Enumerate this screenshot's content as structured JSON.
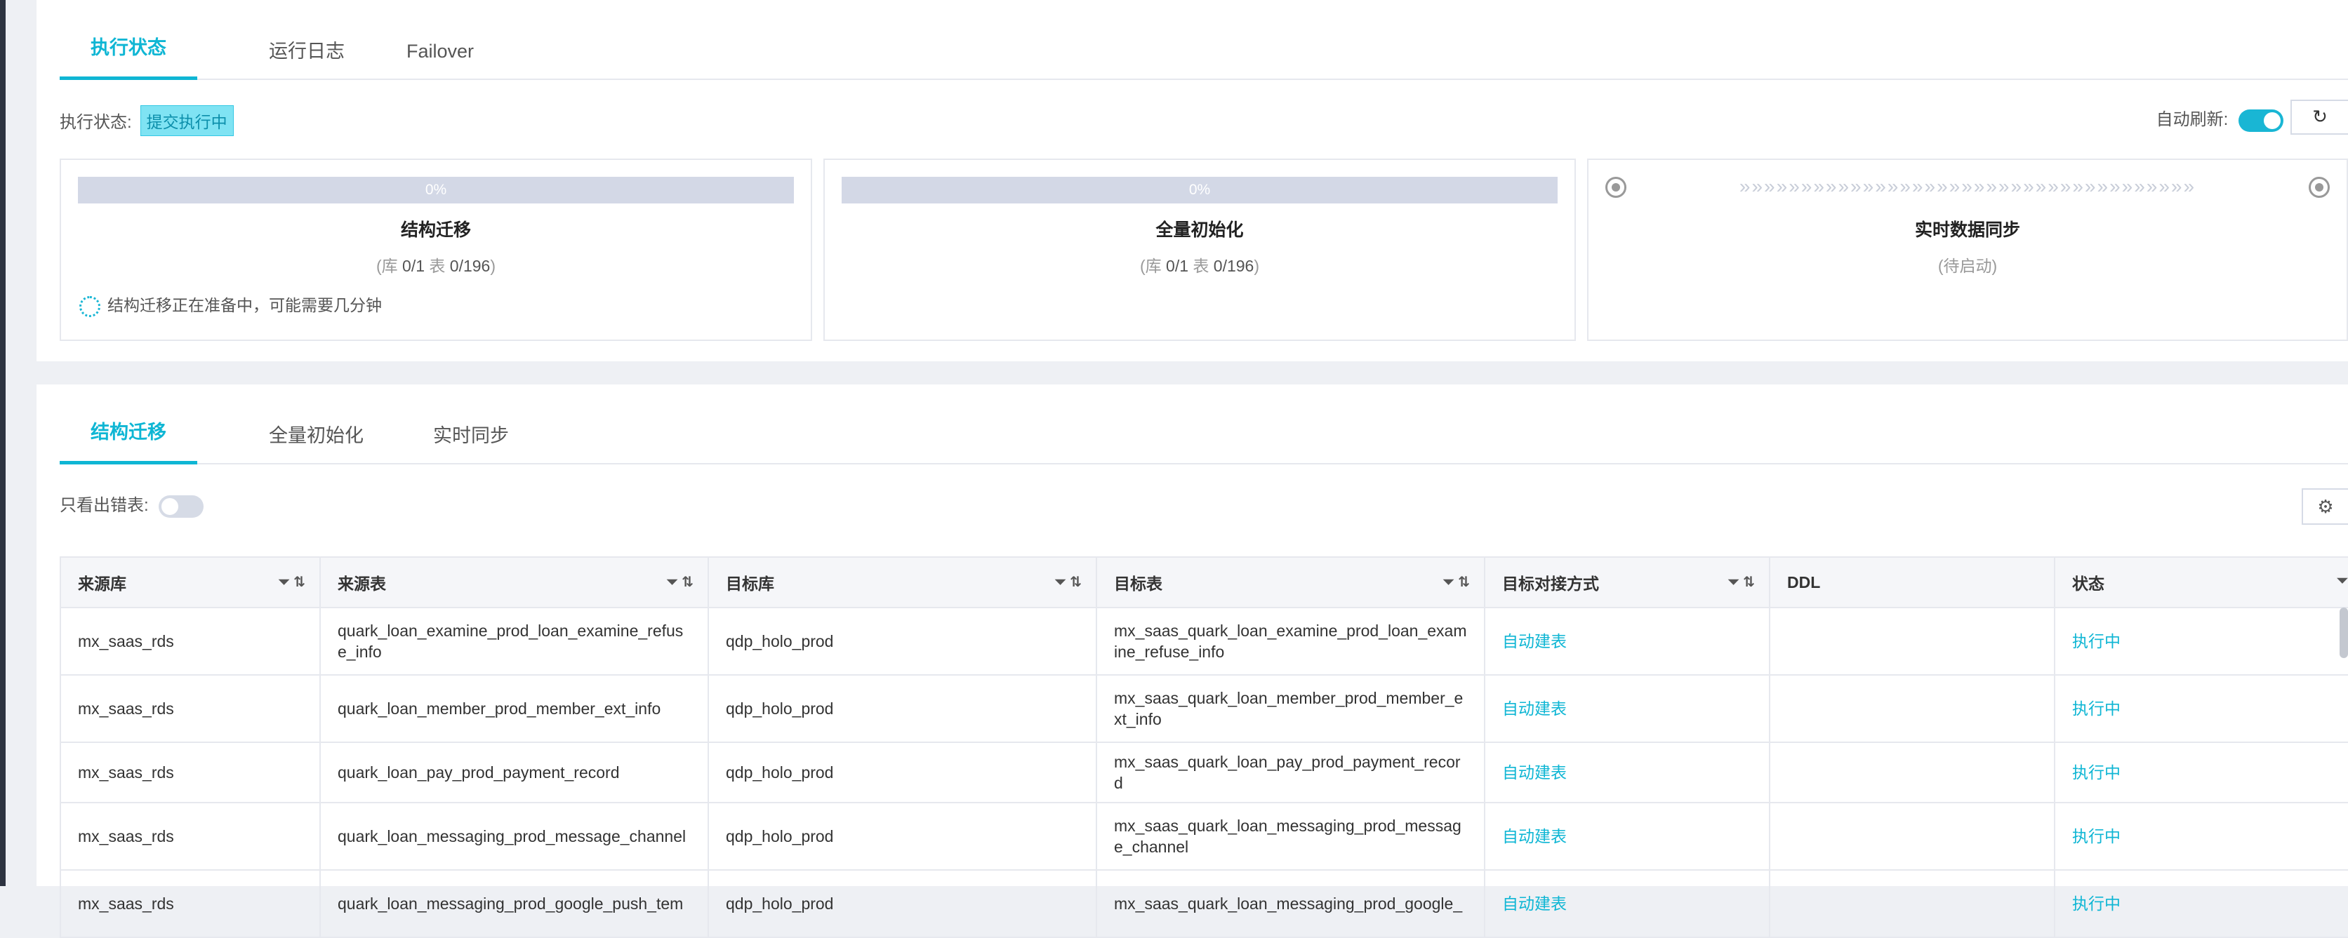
{
  "top_tabs": [
    {
      "label": "执行状态",
      "active": true
    },
    {
      "label": "运行日志",
      "active": false
    },
    {
      "label": "Failover",
      "active": false
    }
  ],
  "status": {
    "label": "执行状态:",
    "badge": "提交执行中"
  },
  "auto_refresh": {
    "label": "自动刷新:",
    "on": true,
    "refresh_icon": "refresh-icon"
  },
  "panels": {
    "structure": {
      "progress": "0%",
      "title": "结构迁移",
      "sub_open": "(",
      "db_label": "库",
      "db_value": "0/1",
      "table_label": "表",
      "table_value": "0/196",
      "sub_close": ")",
      "note": "结构迁移正在准备中，可能需要几分钟"
    },
    "full": {
      "progress": "0%",
      "title": "全量初始化",
      "sub_open": "(",
      "db_label": "库",
      "db_value": "0/1",
      "table_label": "表",
      "table_value": "0/196",
      "sub_close": ")"
    },
    "realtime": {
      "title": "实时数据同步",
      "sub": "(待启动)"
    }
  },
  "detail_tabs": [
    {
      "label": "结构迁移",
      "active": true
    },
    {
      "label": "全量初始化",
      "active": false
    },
    {
      "label": "实时同步",
      "active": false
    }
  ],
  "filter": {
    "label": "只看出错表:",
    "on": false
  },
  "table": {
    "columns": [
      "来源库",
      "来源表",
      "目标库",
      "目标表",
      "目标对接方式",
      "DDL",
      "状态"
    ],
    "rows": [
      [
        "mx_saas_rds",
        "quark_loan_examine_prod_loan_examine_refuse_info",
        "qdp_holo_prod",
        "mx_saas_quark_loan_examine_prod_loan_examine_refuse_info",
        "自动建表",
        "",
        "执行中"
      ],
      [
        "mx_saas_rds",
        "quark_loan_member_prod_member_ext_info",
        "qdp_holo_prod",
        "mx_saas_quark_loan_member_prod_member_ext_info",
        "自动建表",
        "",
        "执行中"
      ],
      [
        "mx_saas_rds",
        "quark_loan_pay_prod_payment_record",
        "qdp_holo_prod",
        "mx_saas_quark_loan_pay_prod_payment_record",
        "自动建表",
        "",
        "执行中"
      ],
      [
        "mx_saas_rds",
        "quark_loan_messaging_prod_message_channel",
        "qdp_holo_prod",
        "mx_saas_quark_loan_messaging_prod_message_channel",
        "自动建表",
        "",
        "执行中"
      ],
      [
        "mx_saas_rds",
        "quark_loan_messaging_prod_google_push_tem",
        "qdp_holo_prod",
        "mx_saas_quark_loan_messaging_prod_google_",
        "自动建表",
        "",
        "执行中"
      ]
    ]
  }
}
